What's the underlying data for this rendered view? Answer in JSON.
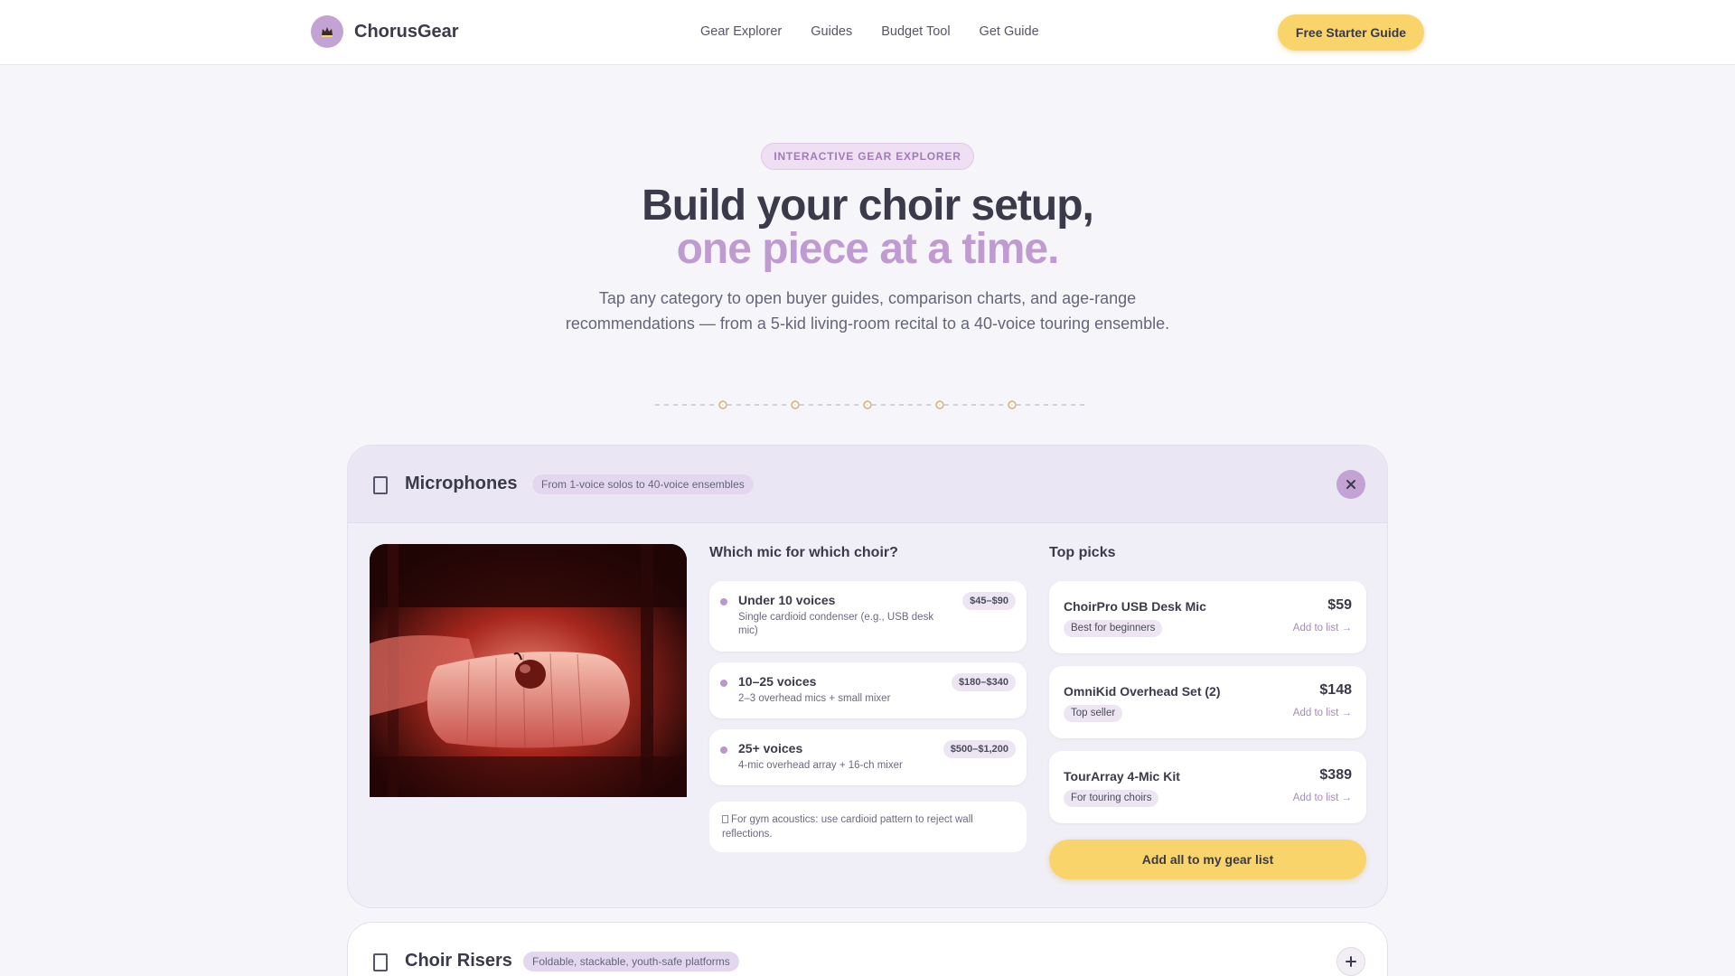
{
  "nav": {
    "brand": "ChorusGear",
    "links": [
      "Gear Explorer",
      "Guides",
      "Budget Tool",
      "Get Guide"
    ],
    "cta": "Free Starter Guide"
  },
  "hero": {
    "pill": "INTERACTIVE GEAR EXPLORER",
    "title_line1": "Build your choir setup,",
    "title_line2": "one piece at a time.",
    "subtitle": "Tap any category to open buyer guides, comparison charts, and age-range recommendations — from a 5-kid living-room recital to a 40-voice touring ensemble."
  },
  "categories": [
    {
      "title": "Microphones",
      "tag": "From 1-voice solos to 40-voice ensembles",
      "expanded": true,
      "guide_title": "Which mic for which choir?",
      "tiers": [
        {
          "title": "Under 10 voices",
          "desc": "Single cardioid condenser (e.g., USB desk mic)",
          "price": "$45–$90"
        },
        {
          "title": "10–25 voices",
          "desc": "2–3 overhead mics + small mixer",
          "price": "$180–$340"
        },
        {
          "title": "25+ voices",
          "desc": "4-mic overhead array + 16-ch mixer",
          "price": "$500–$1,200"
        }
      ],
      "tip": "For gym acoustics: use cardioid pattern to reject wall reflections.",
      "picks_title": "Top picks",
      "picks": [
        {
          "name": "ChoirPro USB Desk Mic",
          "price": "$59",
          "badge": "Best for beginners",
          "action": "Add to list →"
        },
        {
          "name": "OmniKid Overhead Set (2)",
          "price": "$148",
          "badge": "Top seller",
          "action": "Add to list →"
        },
        {
          "name": "TourArray 4-Mic Kit",
          "price": "$389",
          "badge": "For touring choirs",
          "action": "Add to list →"
        }
      ],
      "add_all": "Add all to my gear list"
    },
    {
      "title": "Choir Risers",
      "tag": "Foldable, stackable, youth-safe platforms",
      "expanded": false
    }
  ],
  "colors": {
    "accent_purple": "#c09bd2",
    "accent_yellow": "#f8d46a",
    "text_dark": "#3a3a4a",
    "background": "#f6f6fa"
  },
  "icons": {
    "logo": "crown-icon",
    "category": "document-icon",
    "close": "close-icon",
    "expand": "plus-icon",
    "tip": "info-icon"
  }
}
